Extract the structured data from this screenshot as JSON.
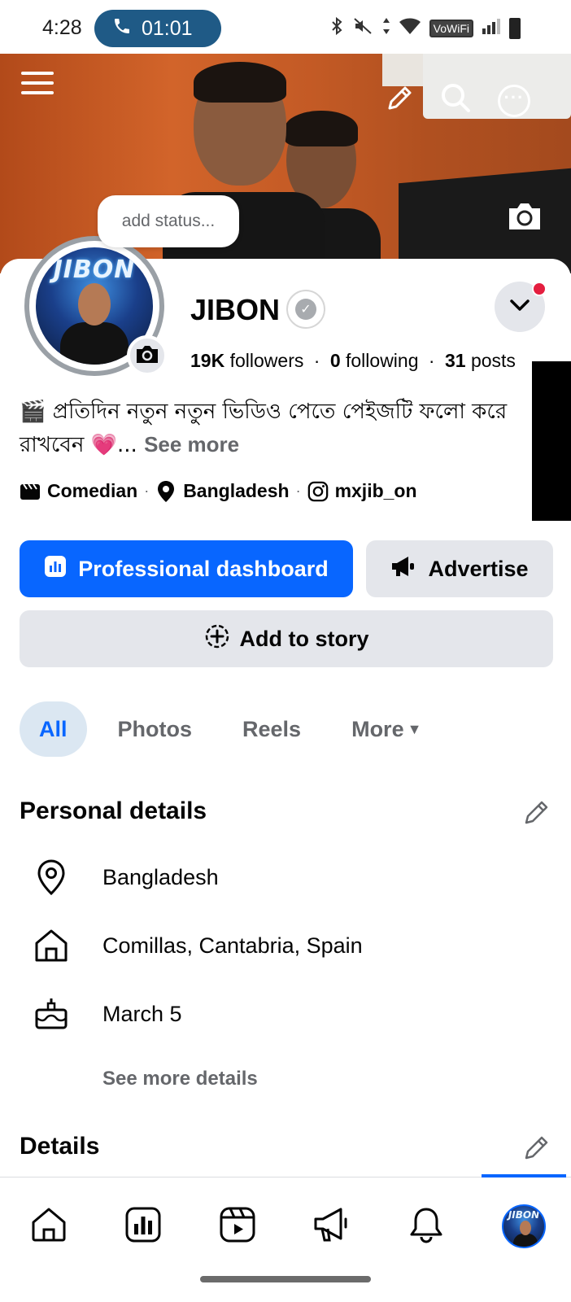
{
  "status_bar": {
    "time": "4:28",
    "call_timer": "01:01",
    "vowifi": "VoWiFi"
  },
  "cover": {
    "status_placeholder": "add status..."
  },
  "profile": {
    "name": "JIBON",
    "avatar_text": "JIBON",
    "followers_count": "19K",
    "followers_label": "followers",
    "following_count": "0",
    "following_label": "following",
    "posts_count": "31",
    "posts_label": "posts",
    "bio_text": "🎬 প্রতিদিন নতুন নতুন ভিডিও পেতে পেইজটি ফলো করে রাখবেন",
    "bio_heart": "💗",
    "bio_ellipsis": "...",
    "see_more": "See more",
    "category": "Comedian",
    "location": "Bangladesh",
    "instagram": "mxjib_on"
  },
  "actions": {
    "professional_dashboard": "Professional dashboard",
    "advertise": "Advertise",
    "add_to_story": "Add to story"
  },
  "tabs": {
    "all": "All",
    "photos": "Photos",
    "reels": "Reels",
    "more": "More"
  },
  "personal_details": {
    "title": "Personal details",
    "items": [
      {
        "icon": "location-pin-icon",
        "text": "Bangladesh"
      },
      {
        "icon": "home-icon",
        "text": "Comillas, Cantabria, Spain"
      },
      {
        "icon": "birthday-cake-icon",
        "text": "March 5"
      }
    ],
    "see_more_details": "See more details"
  },
  "details": {
    "title": "Details"
  },
  "colors": {
    "primary_blue": "#0866ff",
    "secondary_gray": "#e4e6eb",
    "muted_text": "#65676b",
    "active_tab_bg": "#dbe7f2",
    "notification_red": "#e41e3f"
  }
}
